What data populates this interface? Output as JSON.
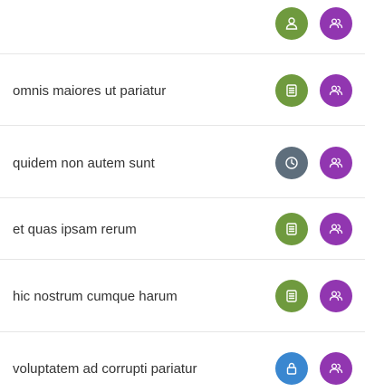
{
  "rows": [
    {
      "label": "",
      "status_icon": "person-icon",
      "status_color": "#6f9a3e",
      "action_icon": "people-icon",
      "action_color": "#9136b0"
    },
    {
      "label": "omnis maiores ut pariatur",
      "status_icon": "document-icon",
      "status_color": "#6f9a3e",
      "action_icon": "people-icon",
      "action_color": "#9136b0"
    },
    {
      "label": "quidem non autem sunt",
      "status_icon": "clock-icon",
      "status_color": "#5e6e7c",
      "action_icon": "people-icon",
      "action_color": "#9136b0"
    },
    {
      "label": "et quas ipsam rerum",
      "status_icon": "document-icon",
      "status_color": "#6f9a3e",
      "action_icon": "people-icon",
      "action_color": "#9136b0"
    },
    {
      "label": "hic nostrum cumque harum",
      "status_icon": "document-icon",
      "status_color": "#6f9a3e",
      "action_icon": "people-icon",
      "action_color": "#9136b0"
    },
    {
      "label": "voluptatem ad corrupti pariatur",
      "status_icon": "lock-icon",
      "status_color": "#3a87d0",
      "action_icon": "people-icon",
      "action_color": "#9136b0"
    }
  ]
}
